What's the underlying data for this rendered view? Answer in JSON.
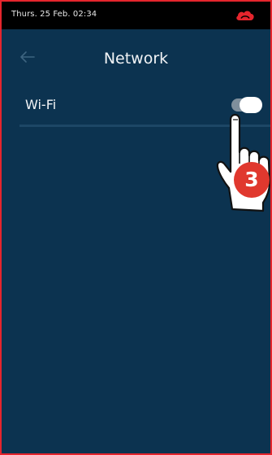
{
  "status_bar": {
    "time": "Thurs. 25 Feb. 02:34",
    "status_icon": "cloud-icon"
  },
  "header": {
    "back_icon": "back-arrow-icon",
    "title": "Network"
  },
  "settings": {
    "wifi": {
      "label": "Wi-Fi",
      "enabled": true
    }
  },
  "annotation": {
    "step_number": "3",
    "hand_icon": "pointing-hand-icon"
  },
  "colors": {
    "background": "#0c3350",
    "frame_border": "#e5252d",
    "status_bar": "#000000",
    "step_badge": "#e0382e",
    "cloud_icon": "#e5252d"
  }
}
